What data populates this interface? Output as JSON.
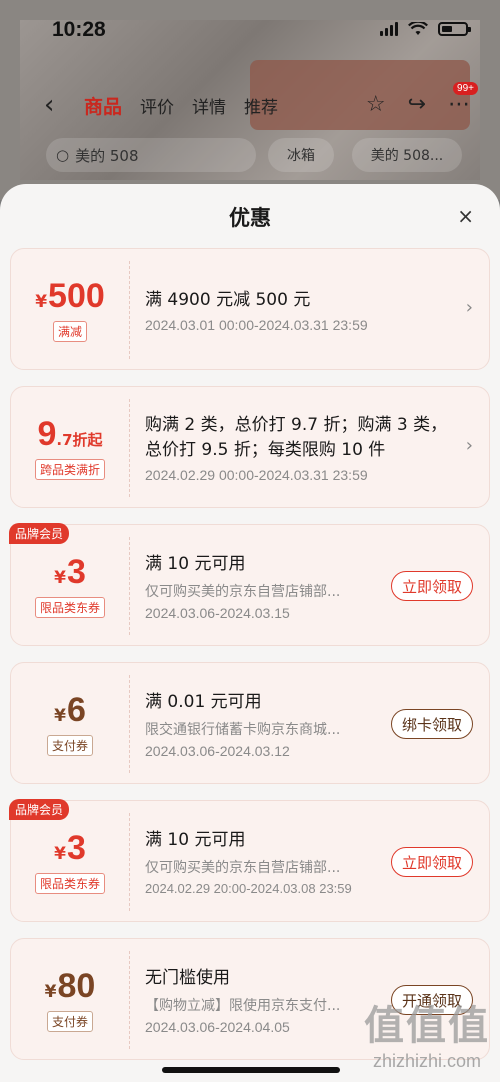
{
  "status": {
    "time": "10:28"
  },
  "nav": {
    "back": "‹",
    "tabs": [
      "商品",
      "评价",
      "详情",
      "推荐"
    ],
    "badge": "99+"
  },
  "search": {
    "text": "美的 508",
    "chips": [
      "冰箱",
      "美的 508..."
    ]
  },
  "sheet": {
    "title": "优惠",
    "close": "×"
  },
  "cards": [
    {
      "currency": "¥",
      "amount": "500",
      "tag": "满减",
      "title": "满 4900 元减 500 元",
      "date": "2024.03.01 00:00-2024.03.31 23:59"
    },
    {
      "amount": "9",
      "amount_sub": ".7折起",
      "tag": "跨品类满折",
      "title": "购满 2 类，总价打 9.7 折；购满 3 类，总价打 9.5 折；每类限购 10 件",
      "date": "2024.02.29 00:00-2024.03.31 23:59"
    },
    {
      "badge": "品牌会员",
      "currency": "¥",
      "amount": "3",
      "tag": "限品类东券",
      "title": "满 10 元可用",
      "desc": "仅可购买美的京东自营店铺部...",
      "date": "2024.03.06-2024.03.15",
      "button": "立即领取"
    },
    {
      "currency": "¥",
      "amount": "6",
      "tag": "支付券",
      "title": "满 0.01 元可用",
      "desc": "限交通银行储蓄卡购京东商城...",
      "date": "2024.03.06-2024.03.12",
      "button": "绑卡领取"
    },
    {
      "badge": "品牌会员",
      "currency": "¥",
      "amount": "3",
      "tag": "限品类东券",
      "title": "满 10 元可用",
      "desc": "仅可购买美的京东自营店铺部...",
      "date": "2024.02.29 20:00-2024.03.08 23:59",
      "button": "立即领取"
    },
    {
      "currency": "¥",
      "amount": "80",
      "tag": "支付券",
      "title": "无门槛使用",
      "desc": "【购物立减】限使用京东支付...",
      "date": "2024.03.06-2024.04.05",
      "button": "开通领取"
    }
  ],
  "watermark": {
    "logo": "值值值",
    "site": "zhizhizhi.com"
  },
  "colors": {
    "accent_red": "#e0392b",
    "brown": "#7a4524",
    "card_bg": "#fbf2ef"
  }
}
